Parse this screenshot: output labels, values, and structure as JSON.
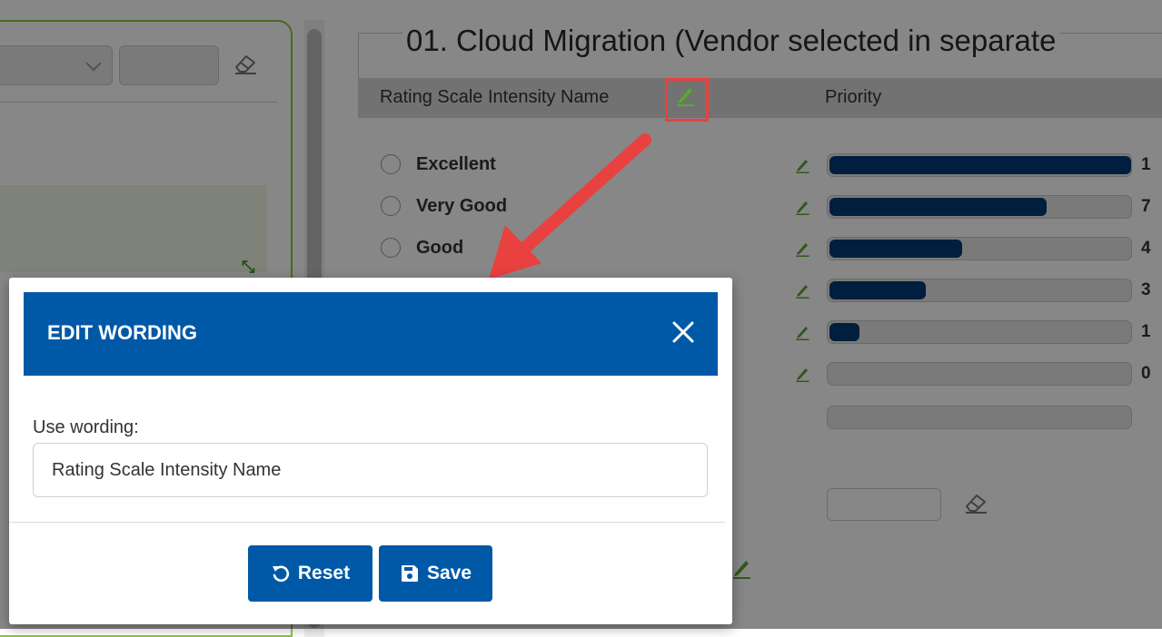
{
  "page": {
    "title": "01. Cloud Migration (Vendor selected in separate",
    "column_rating": "Rating Scale Intensity Name",
    "column_priority": "Priority"
  },
  "options": [
    {
      "label": "Excellent"
    },
    {
      "label": "Very Good"
    },
    {
      "label": "Good"
    }
  ],
  "priority_bars": [
    {
      "fill": 1.0,
      "value": "1"
    },
    {
      "fill": 0.72,
      "value": "7"
    },
    {
      "fill": 0.44,
      "value": "4"
    },
    {
      "fill": 0.32,
      "value": "3"
    },
    {
      "fill": 0.1,
      "value": "1"
    },
    {
      "fill": 0.0,
      "value": "0"
    }
  ],
  "modal": {
    "title": "EDIT WORDING",
    "field_label": "Use wording:",
    "field_value": "Rating Scale Intensity Name",
    "reset_label": "Reset",
    "save_label": "Save"
  },
  "icons": {
    "edit": "pencil-icon",
    "eraser": "eraser-icon",
    "close": "close-icon",
    "reset": "undo-icon",
    "save": "floppy-disk-icon",
    "expand": "expand-arrows-icon"
  },
  "colors": {
    "modal_header": "#0059a6",
    "button": "#0059a6",
    "bar_fill": "#003a73",
    "edit_pencil": "#5aa832",
    "highlight": "#e8413f",
    "panel_border": "#8dc63f"
  }
}
